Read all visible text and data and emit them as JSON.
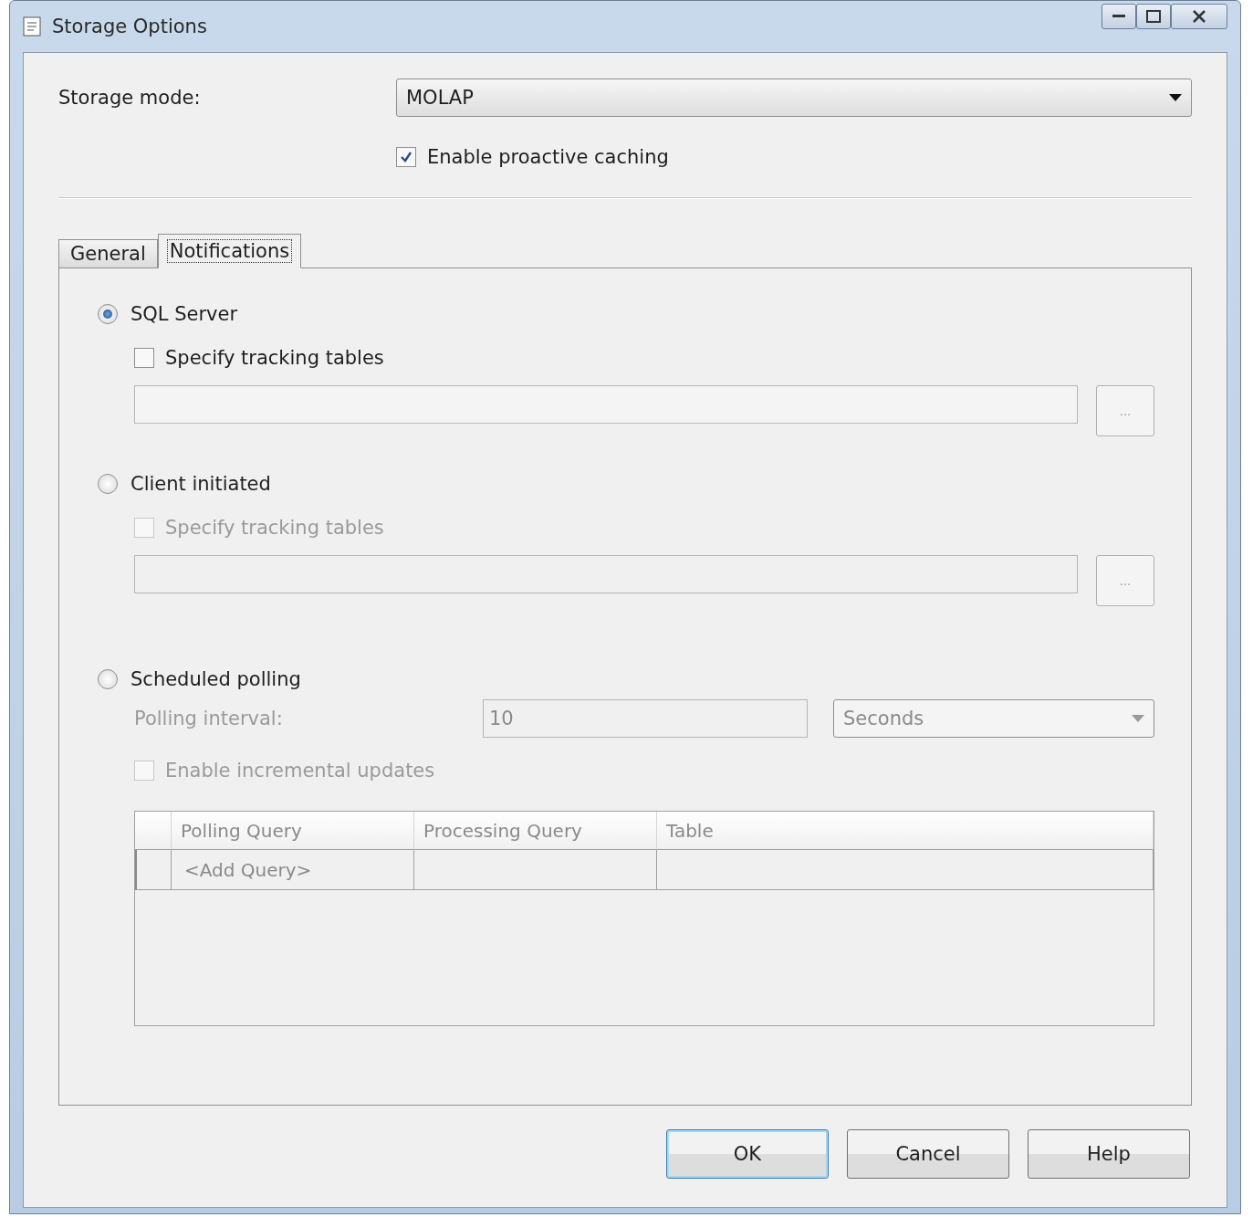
{
  "window": {
    "title": "Storage Options"
  },
  "storage_mode": {
    "label": "Storage mode:",
    "value": "MOLAP"
  },
  "proactive_caching": {
    "label": "Enable proactive caching",
    "checked": true
  },
  "tabs": [
    {
      "label": "General",
      "selected": false
    },
    {
      "label": "Notifications",
      "selected": true
    }
  ],
  "notification_options": [
    {
      "kind": "tracking",
      "label": "SQL Server",
      "selected": true,
      "tracking_tables": {
        "label": "Specify tracking tables",
        "checked": false,
        "disabled": false
      },
      "browse_button": "..."
    },
    {
      "kind": "tracking",
      "label": "Client initiated",
      "selected": false,
      "tracking_tables": {
        "label": "Specify tracking tables",
        "checked": false,
        "disabled": true
      },
      "browse_button": "..."
    },
    {
      "kind": "polling",
      "label": "Scheduled polling",
      "selected": false,
      "disabled": true,
      "interval": {
        "label": "Polling interval:",
        "value": "10",
        "unit": "Seconds"
      },
      "incremental_updates": {
        "label": "Enable incremental updates",
        "checked": false
      },
      "grid": {
        "columns": [
          "Polling Query",
          "Processing Query",
          "Table"
        ],
        "rows": [
          {
            "polling_query": "<Add Query>"
          }
        ]
      }
    }
  ],
  "buttons": [
    {
      "label": "OK",
      "default": true
    },
    {
      "label": "Cancel",
      "default": false
    },
    {
      "label": "Help",
      "default": false
    }
  ]
}
